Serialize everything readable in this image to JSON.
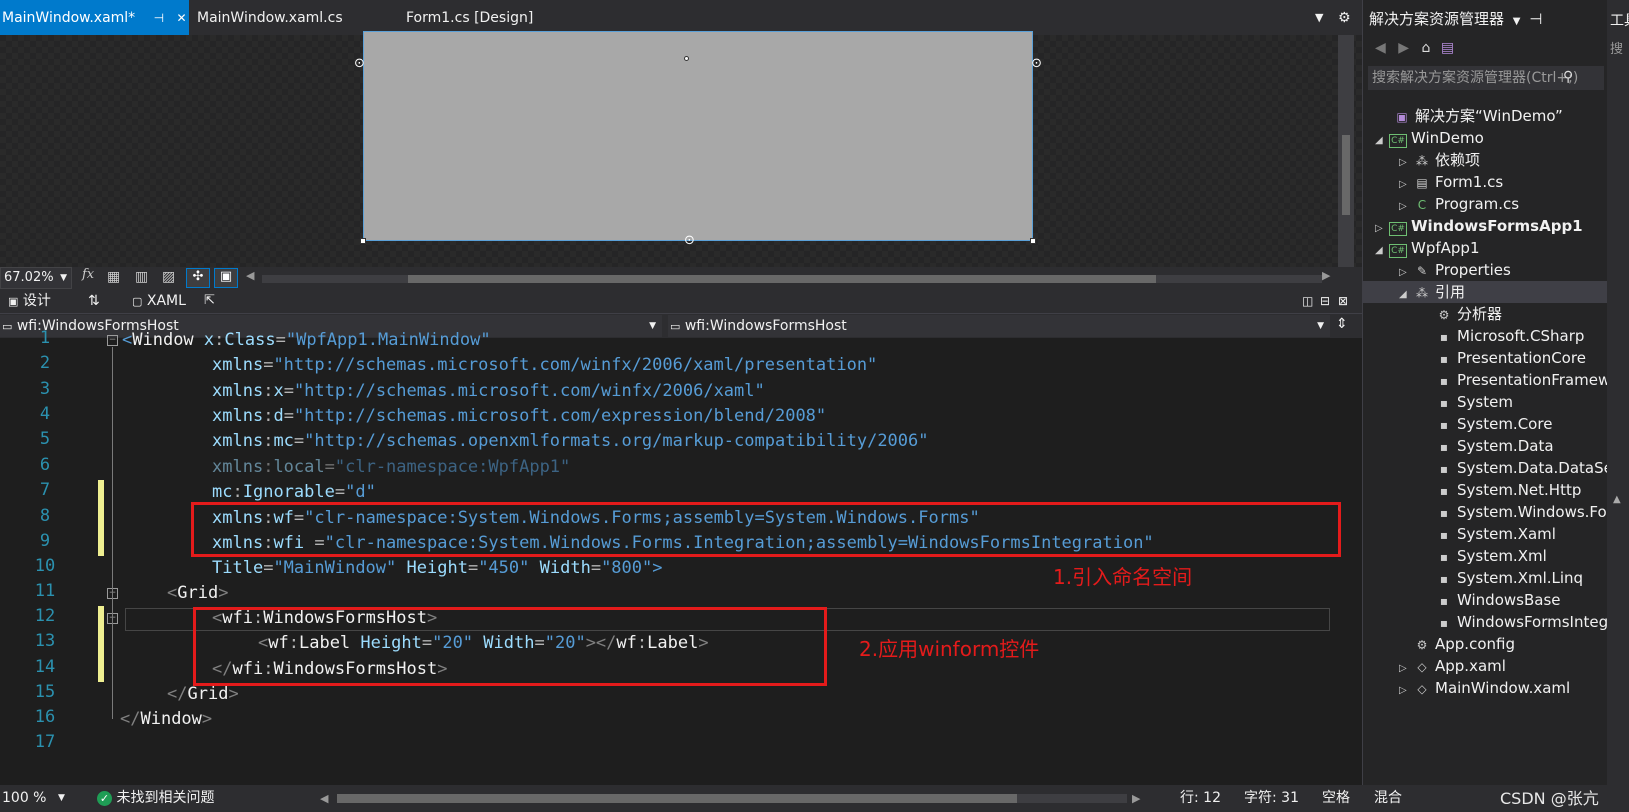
{
  "tabs": [
    {
      "label": "MainWindow.xaml*",
      "active": true
    },
    {
      "label": "MainWindow.xaml.cs",
      "active": false
    },
    {
      "label": "Form1.cs [Design]",
      "active": false
    }
  ],
  "designer_toolbar": {
    "zoom": "67.02%",
    "fx": "fx"
  },
  "split_tabs": {
    "design": "设计",
    "swap": "⇅",
    "xaml": "XAML"
  },
  "nav": {
    "left": "wfi:WindowsFormsHost",
    "right": "wfi:WindowsFormsHost"
  },
  "code": {
    "lines": [
      "1",
      "2",
      "3",
      "4",
      "5",
      "6",
      "7",
      "8",
      "9",
      "10",
      "11",
      "12",
      "13",
      "14",
      "15",
      "16",
      "17"
    ],
    "l1": {
      "open": "<",
      "el": "Window",
      "a1": "x",
      "c": ":",
      "a2": "Class",
      "eq": "=",
      "v": "\"WpfApp1.MainWindow\""
    },
    "l2": {
      "p": "xmlns",
      "eq": "=",
      "v": "\"http://schemas.microsoft.com/winfx/2006/xaml/presentation\""
    },
    "l3": {
      "p": "xmlns",
      "c": ":",
      "a": "x",
      "eq": "=",
      "v": "\"http://schemas.microsoft.com/winfx/2006/xaml\""
    },
    "l4": {
      "p": "xmlns",
      "c": ":",
      "a": "d",
      "eq": "=",
      "v": "\"http://schemas.microsoft.com/expression/blend/2008\""
    },
    "l5": {
      "p": "xmlns",
      "c": ":",
      "a": "mc",
      "eq": "=",
      "v": "\"http://schemas.openxmlformats.org/markup-compatibility/2006\""
    },
    "l6": {
      "p": "xmlns",
      "c": ":",
      "a": "local",
      "eq": "=",
      "v": "\"clr-namespace:WpfApp1\""
    },
    "l7": {
      "p": "mc",
      "c": ":",
      "a": "Ignorable",
      "eq": "=",
      "v": "\"d\""
    },
    "l8": {
      "p": "xmlns",
      "c": ":",
      "a": "wf",
      "eq": "=",
      "v": "\"clr-namespace:System.Windows.Forms;assembly=System.Windows.Forms\""
    },
    "l9": {
      "p": "xmlns",
      "c": ":",
      "a": "wfi ",
      "eq": "=",
      "v": "\"clr-namespace:System.Windows.Forms.Integration;assembly=WindowsFormsIntegration\""
    },
    "l10": {
      "a1": "Title",
      "v1": "\"MainWindow\"",
      "a2": "Height",
      "v2": "\"450\"",
      "a3": "Width",
      "v3": "\"800\"",
      "close": ">"
    },
    "l11": {
      "open": "<",
      "el": "Grid",
      "close": ">"
    },
    "l12": {
      "open": "<",
      "p": "wfi",
      "c": ":",
      "el": "WindowsFormsHost",
      "close": ">"
    },
    "l13": {
      "open": "<",
      "p": "wf",
      "c": ":",
      "el": "Label",
      "a1": "Height",
      "v1": "\"20\"",
      "a2": "Width",
      "v2": "\"20\"",
      "mid": "></",
      "p2": "wf",
      "el2": "Label",
      "close": ">"
    },
    "l14": {
      "open": "</",
      "p": "wfi",
      "c": ":",
      "el": "WindowsFormsHost",
      "close": ">"
    },
    "l15": {
      "open": "</",
      "el": "Grid",
      "close": ">"
    },
    "l16": {
      "open": "</",
      "el": "Window",
      "close": ">"
    }
  },
  "annotations": {
    "a1": "1.引入命名空间",
    "a2": "2.应用winform控件"
  },
  "status": {
    "zoom": "100 %",
    "issues": "未找到相关问题",
    "line": "行: 12",
    "char": "字符: 31",
    "space": "空格",
    "mode": "混合",
    "watermark": "CSDN @张亢"
  },
  "solution_explorer": {
    "title": "解决方案资源管理器",
    "search_placeholder": "搜索解决方案资源管理器(Ctrl+;)",
    "nodes": [
      {
        "label": "解决方案“WinDemo”",
        "icon": "solution-icon"
      },
      {
        "label": "WinDemo",
        "icon": "csharp-project-icon"
      },
      {
        "label": "依赖项",
        "icon": "dependencies-icon"
      },
      {
        "label": "Form1.cs",
        "icon": "form-icon"
      },
      {
        "label": "Program.cs",
        "icon": "csharp-file-icon"
      },
      {
        "label": "WindowsFormsApp1",
        "icon": "csharp-project-icon"
      },
      {
        "label": "WpfApp1",
        "icon": "csharp-project-icon"
      },
      {
        "label": "Properties",
        "icon": "wrench-icon"
      },
      {
        "label": "引用",
        "icon": "references-icon"
      },
      {
        "label": "分析器",
        "icon": "analyzer-icon"
      },
      {
        "label": "Microsoft.CSharp",
        "icon": "assembly-icon"
      },
      {
        "label": "PresentationCore",
        "icon": "assembly-icon"
      },
      {
        "label": "PresentationFramework",
        "icon": "assembly-icon"
      },
      {
        "label": "System",
        "icon": "assembly-icon"
      },
      {
        "label": "System.Core",
        "icon": "assembly-icon"
      },
      {
        "label": "System.Data",
        "icon": "assembly-icon"
      },
      {
        "label": "System.Data.DataSetExtensions",
        "icon": "assembly-icon"
      },
      {
        "label": "System.Net.Http",
        "icon": "assembly-icon"
      },
      {
        "label": "System.Windows.Forms",
        "icon": "assembly-icon"
      },
      {
        "label": "System.Xaml",
        "icon": "assembly-icon"
      },
      {
        "label": "System.Xml",
        "icon": "assembly-icon"
      },
      {
        "label": "System.Xml.Linq",
        "icon": "assembly-icon"
      },
      {
        "label": "WindowsBase",
        "icon": "assembly-icon"
      },
      {
        "label": "WindowsFormsIntegration",
        "icon": "assembly-icon"
      },
      {
        "label": "App.config",
        "icon": "config-icon"
      },
      {
        "label": "App.xaml",
        "icon": "xaml-icon"
      },
      {
        "label": "MainWindow.xaml",
        "icon": "xaml-icon"
      }
    ]
  },
  "far_right": {
    "toolbox": "工具箱",
    "search": "搜"
  }
}
